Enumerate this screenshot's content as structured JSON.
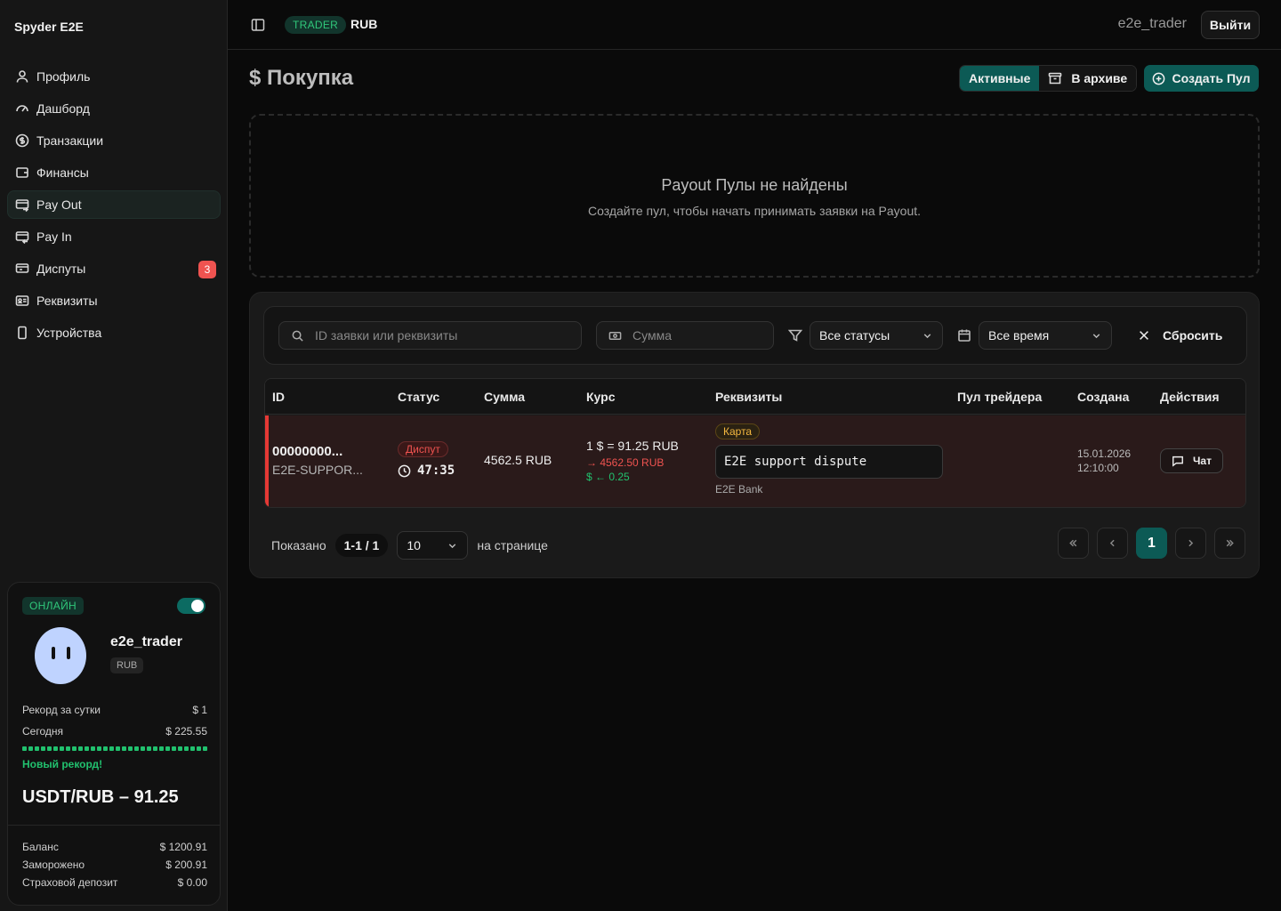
{
  "sidebar": {
    "brand": "Spyder E2E",
    "items": [
      {
        "label": "Профиль",
        "icon": "user-icon"
      },
      {
        "label": "Дашборд",
        "icon": "gauge-icon"
      },
      {
        "label": "Транзакции",
        "icon": "dollar-circle-icon"
      },
      {
        "label": "Финансы",
        "icon": "wallet-icon"
      },
      {
        "label": "Pay Out",
        "icon": "card-out-icon",
        "active": true
      },
      {
        "label": "Pay In",
        "icon": "card-in-icon"
      },
      {
        "label": "Диспуты",
        "icon": "dispute-icon",
        "badge": "3"
      },
      {
        "label": "Реквизиты",
        "icon": "id-card-icon"
      },
      {
        "label": "Устройства",
        "icon": "phone-icon"
      }
    ],
    "card": {
      "status": "ОНЛАЙН",
      "username": "e2e_trader",
      "currency": "RUB",
      "record_label": "Рекорд за сутки",
      "record_value": "$ 1",
      "today_label": "Сегодня",
      "today_value": "$ 225.55",
      "progress_fraction": 1.0,
      "new_record": "Новый рекорд!",
      "rate": "USDT/RUB – 91.25",
      "balance_label": "Баланс",
      "balance_value": "$ 1200.91",
      "frozen_label": "Заморожено",
      "frozen_value": "$ 200.91",
      "deposit_label": "Страховой депозит",
      "deposit_value": "$ 0.00"
    }
  },
  "header": {
    "role": "TRADER",
    "currency": "RUB",
    "username": "e2e_trader",
    "logout": "Выйти"
  },
  "main": {
    "title": "$ Покупка",
    "tab_active": "Активные",
    "tab_archive": "В архиве",
    "create_button": "Создать Пул",
    "empty_title": "Payout Пулы не найдены",
    "empty_subtitle": "Создайте пул, чтобы начать принимать заявки на Payout.",
    "filters": {
      "search_placeholder": "ID заявки или реквизиты",
      "amount_placeholder": "Сумма",
      "status": "Все статусы",
      "time": "Все время",
      "reset": "Сбросить"
    },
    "columns": [
      "ID",
      "Статус",
      "Сумма",
      "Курс",
      "Реквизиты",
      "Пул трейдера",
      "Создана",
      "Действия"
    ],
    "row": {
      "id": "00000000...",
      "id_sub": "E2E-SUPPOR...",
      "status": "Диспут",
      "timer": "47:35",
      "amount": "4562.5 RUB",
      "rate": "1 $ = 91.25 RUB",
      "rate_rub": "→ 4562.50 RUB",
      "rate_usd": "$ ← 0.25",
      "req_type": "Карта",
      "req_text": "E2E support dispute",
      "req_bank": "E2E Bank",
      "pool": "",
      "created_date": "15.01.2026",
      "created_time": "12:10:00",
      "action": "Чат"
    },
    "pager": {
      "shown_label": "Показано",
      "range": "1-1 / 1",
      "per_page": "10",
      "per_page_label": "на странице",
      "current": "1"
    }
  },
  "colors": {
    "accent": "#0c5a55",
    "online": "#30c77a",
    "danger": "#e53935",
    "warning": "#f5b840"
  }
}
